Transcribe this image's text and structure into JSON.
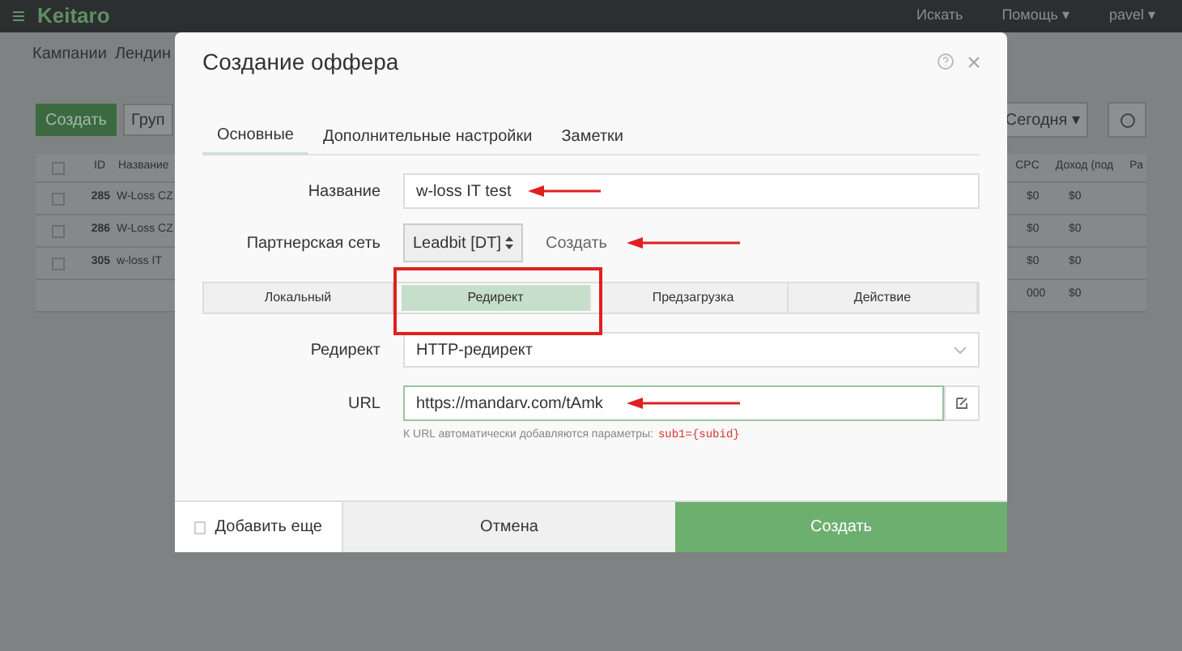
{
  "app": {
    "brand": "Keitaro",
    "header_links": [
      "Искать",
      "Помощь ▾",
      "pavel ▾"
    ],
    "nav": [
      "Кампании",
      "Лендин"
    ],
    "toolbar": {
      "create": "Создать",
      "group": "Груп",
      "period": "Сегодня ▾"
    },
    "table": {
      "columns": [
        "ID",
        "Название"
      ],
      "right_columns": [
        "CPC",
        "Доход (под",
        "Ра"
      ],
      "header_checked": false,
      "rows": [
        {
          "id": "285",
          "name": "W-Loss CZ",
          "cpc": "$0",
          "income": "$0",
          "checked": false
        },
        {
          "id": "286",
          "name": "W-Loss CZ",
          "cpc": "$0",
          "income": "$0",
          "checked": false
        },
        {
          "id": "305",
          "name": "w-loss IT",
          "cpc": "$0",
          "income": "$0",
          "checked": false
        },
        {
          "cpc": "000",
          "income": "$0"
        }
      ]
    }
  },
  "dialog": {
    "title": "Создание оффера",
    "tabs": [
      {
        "label": "Основные",
        "selected": true
      },
      {
        "label": "Дополнительные настройки",
        "selected": false
      },
      {
        "label": "Заметки",
        "selected": false
      }
    ],
    "name": {
      "label": "Название",
      "value": "w-loss IT test"
    },
    "network": {
      "label": "Партнерская сеть",
      "value": "Leadbit [DT]",
      "create_link": "Создать"
    },
    "modes": [
      {
        "label": "Локальный",
        "selected": false
      },
      {
        "label": "Редирект",
        "selected": true
      },
      {
        "label": "Предзагрузка",
        "selected": false
      },
      {
        "label": "Действие",
        "selected": false
      }
    ],
    "redirect": {
      "label": "Редирект",
      "value": "HTTP-редирект"
    },
    "url": {
      "label": "URL",
      "value": "https://mandarv.com/tAmk",
      "hint": "К URL автоматически добавляются параметры:",
      "hint_code": "sub1={subid}"
    },
    "add_more": {
      "label": "Добавить еще",
      "checked": false
    },
    "cancel": "Отмена",
    "submit": "Создать"
  }
}
